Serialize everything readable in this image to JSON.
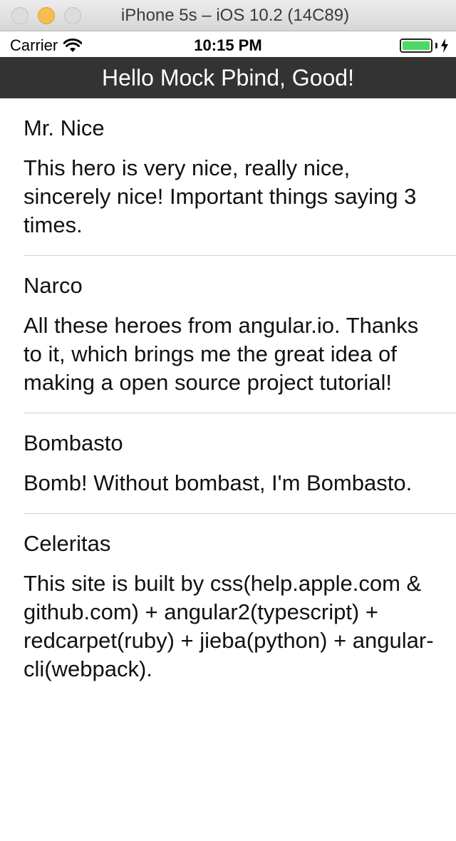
{
  "window": {
    "title": "iPhone 5s – iOS 10.2 (14C89)"
  },
  "status_bar": {
    "carrier": "Carrier",
    "time": "10:15 PM",
    "battery_color": "#4cd964",
    "battery_level": 1.0
  },
  "nav": {
    "title": "Hello Mock Pbind, Good!",
    "background": "#333333"
  },
  "heroes": [
    {
      "name": "Mr. Nice",
      "description": "This hero is very nice, really nice, sincerely nice! Important things saying 3 times."
    },
    {
      "name": "Narco",
      "description": "All these heroes from angular.io. Thanks to it, which brings me the great idea of making a open source project tutorial!"
    },
    {
      "name": "Bombasto",
      "description": "Bomb! Without bombast, I'm Bombasto."
    },
    {
      "name": "Celeritas",
      "description": "This site is built by css(help.apple.com & github.com) + angular2(typescript) + redcarpet(ruby) + jieba(python) + angular-cli(webpack)."
    }
  ]
}
